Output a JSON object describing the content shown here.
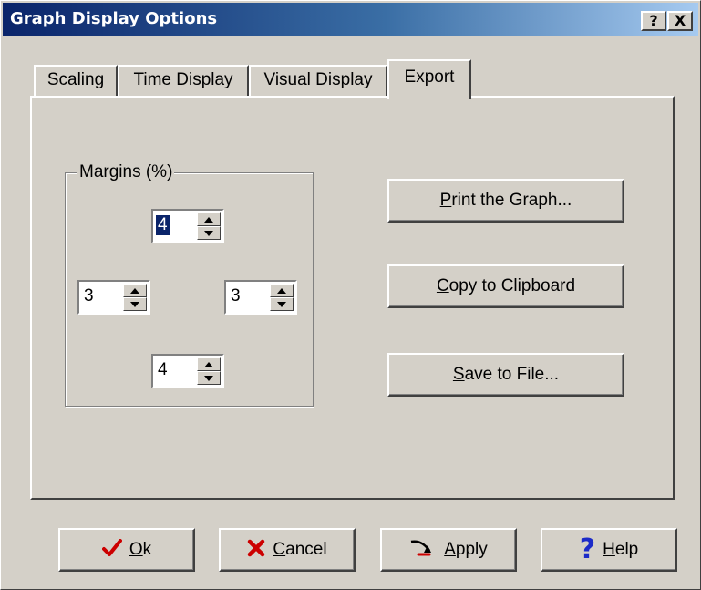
{
  "window": {
    "title": "Graph Display Options",
    "help_glyph": "?",
    "close_glyph": "X"
  },
  "tabs": [
    {
      "label": "Scaling",
      "active": false
    },
    {
      "label": "Time Display",
      "active": false
    },
    {
      "label": "Visual Display",
      "active": false
    },
    {
      "label": "Export",
      "active": true
    }
  ],
  "margins": {
    "label": "Margins (%)",
    "top": "4",
    "left": "3",
    "right": "3",
    "bottom": "4"
  },
  "export_buttons": {
    "print": {
      "mnemonic": "P",
      "rest": "rint the Graph..."
    },
    "copy": {
      "mnemonic": "C",
      "rest": "opy to Clipboard"
    },
    "save": {
      "mnemonic": "S",
      "rest": "ave to File..."
    }
  },
  "footer_buttons": {
    "ok": {
      "mnemonic": "O",
      "rest": "k",
      "icon": "checkmark-icon"
    },
    "cancel": {
      "mnemonic": "C",
      "rest": "ancel",
      "icon": "x-icon"
    },
    "apply": {
      "mnemonic": "A",
      "rest": "pply",
      "icon": "apply-icon"
    },
    "help": {
      "mnemonic": "H",
      "rest": "elp",
      "icon": "question-icon"
    }
  },
  "colors": {
    "face": "#d4d0c8",
    "title_start": "#0a246a",
    "title_end": "#a6caf0",
    "ok_check": "#cc0000",
    "cancel_x": "#cc0000",
    "help_question": "#1c2bc8"
  }
}
